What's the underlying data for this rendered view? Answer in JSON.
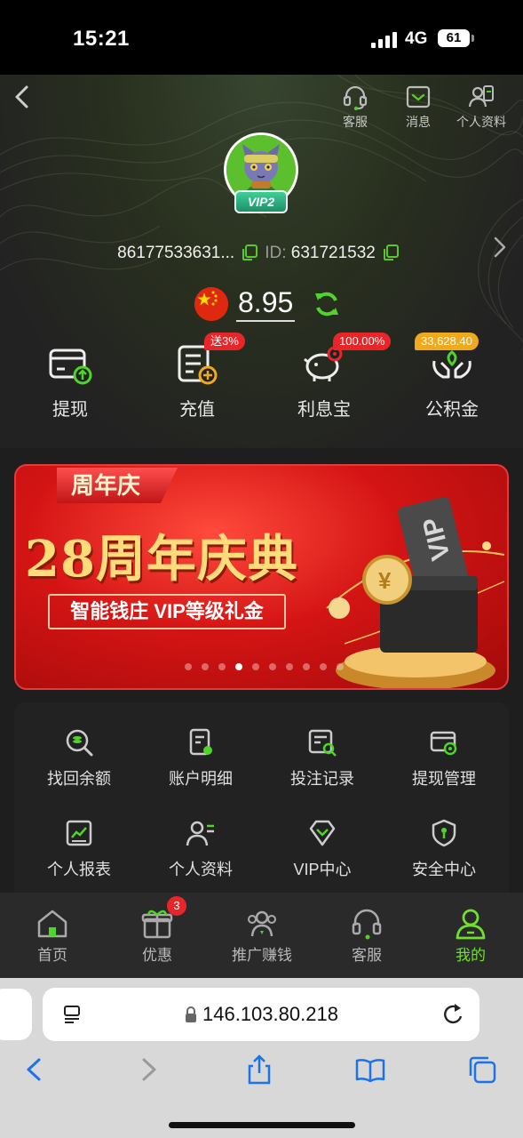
{
  "status_bar": {
    "time": "15:21",
    "network": "4G",
    "battery": "61"
  },
  "header": {
    "actions": [
      {
        "label": "客服",
        "icon": "headset-icon"
      },
      {
        "label": "消息",
        "icon": "message-icon"
      },
      {
        "label": "个人资料",
        "icon": "profile-icon"
      }
    ],
    "vip_level": "VIP2",
    "account": "86177533631...",
    "id_label": "ID:",
    "id_value": "631721532",
    "balance": "8.95",
    "quick_actions": [
      {
        "label": "提现",
        "icon": "withdraw-card-icon",
        "badge": ""
      },
      {
        "label": "充值",
        "icon": "deposit-icon",
        "badge": "送3%"
      },
      {
        "label": "利息宝",
        "icon": "piggy-bank-icon",
        "badge": "100.00%"
      },
      {
        "label": "公积金",
        "icon": "fund-hands-icon",
        "badge": "33,628.40"
      }
    ]
  },
  "banner": {
    "tag": "周年庆",
    "title": "28周年庆典",
    "subtitle": "智能钱庄 VIP等级礼金",
    "art_text": "VIP",
    "dots_total": 10,
    "dot_active": 3
  },
  "menu": {
    "items": [
      {
        "label": "找回余额",
        "icon": "search-coins-icon"
      },
      {
        "label": "账户明细",
        "icon": "account-detail-icon"
      },
      {
        "label": "投注记录",
        "icon": "bet-record-icon"
      },
      {
        "label": "提现管理",
        "icon": "withdraw-manage-icon"
      },
      {
        "label": "个人报表",
        "icon": "report-chart-icon"
      },
      {
        "label": "个人资料",
        "icon": "profile-card-icon"
      },
      {
        "label": "VIP中心",
        "icon": "vip-diamond-icon"
      },
      {
        "label": "安全中心",
        "icon": "shield-icon"
      }
    ]
  },
  "tabbar": {
    "tabs": [
      {
        "label": "首页",
        "icon": "home-icon"
      },
      {
        "label": "优惠",
        "icon": "gift-icon",
        "badge": "3"
      },
      {
        "label": "推广赚钱",
        "icon": "people-icon"
      },
      {
        "label": "客服",
        "icon": "headset-icon"
      },
      {
        "label": "我的",
        "icon": "user-icon",
        "active": true
      }
    ]
  },
  "browser": {
    "url": "146.103.80.218"
  },
  "colors": {
    "accent_green": "#6fe030",
    "badge_red": "#e8262a",
    "badge_gold": "#f0a81c",
    "banner_red": "#d41414"
  }
}
